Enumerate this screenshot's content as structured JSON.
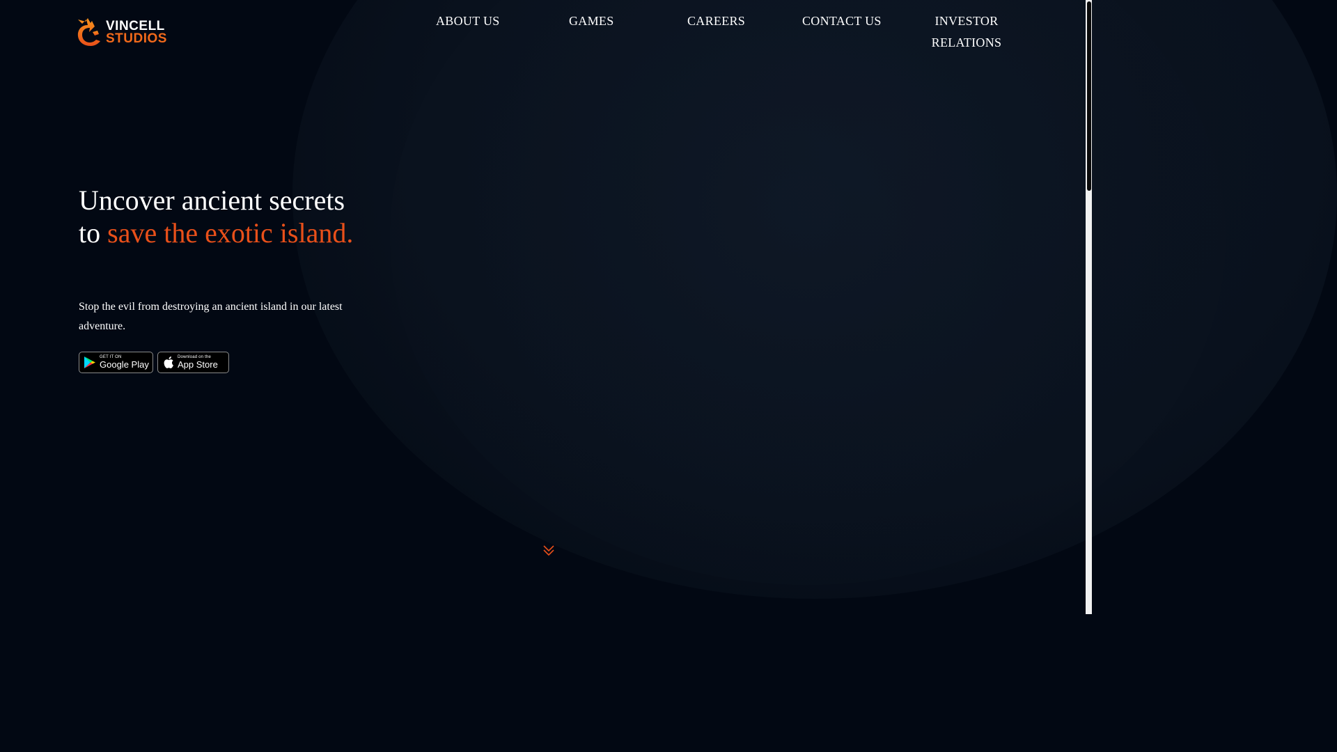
{
  "brand": {
    "name_line1": "VINCELL",
    "name_line2": "STUDIOS",
    "logo_icon": "dragon-logo-icon",
    "accent_color": "#f26a1b"
  },
  "nav": {
    "items": [
      {
        "label": "ABOUT US"
      },
      {
        "label": "GAMES"
      },
      {
        "label": "CAREERS"
      },
      {
        "label": "CONTACT US"
      },
      {
        "label": "INVESTOR RELATIONS"
      }
    ]
  },
  "hero": {
    "title_plain": "Uncover ancient secrets to ",
    "title_accent": "save the exotic island.",
    "title_accent_color": "#e9501a",
    "subtitle": "Stop the evil from destroying an ancient island in our latest adventure."
  },
  "stores": {
    "google": {
      "small": "GET IT ON",
      "big": "Google Play",
      "icon": "google-play-icon"
    },
    "apple": {
      "small": "Download on the",
      "big": "App Store",
      "icon": "apple-icon"
    }
  },
  "scroll": {
    "icon": "double-chevron-down-icon"
  },
  "colors": {
    "background": "#020813",
    "text": "#ffffff"
  }
}
